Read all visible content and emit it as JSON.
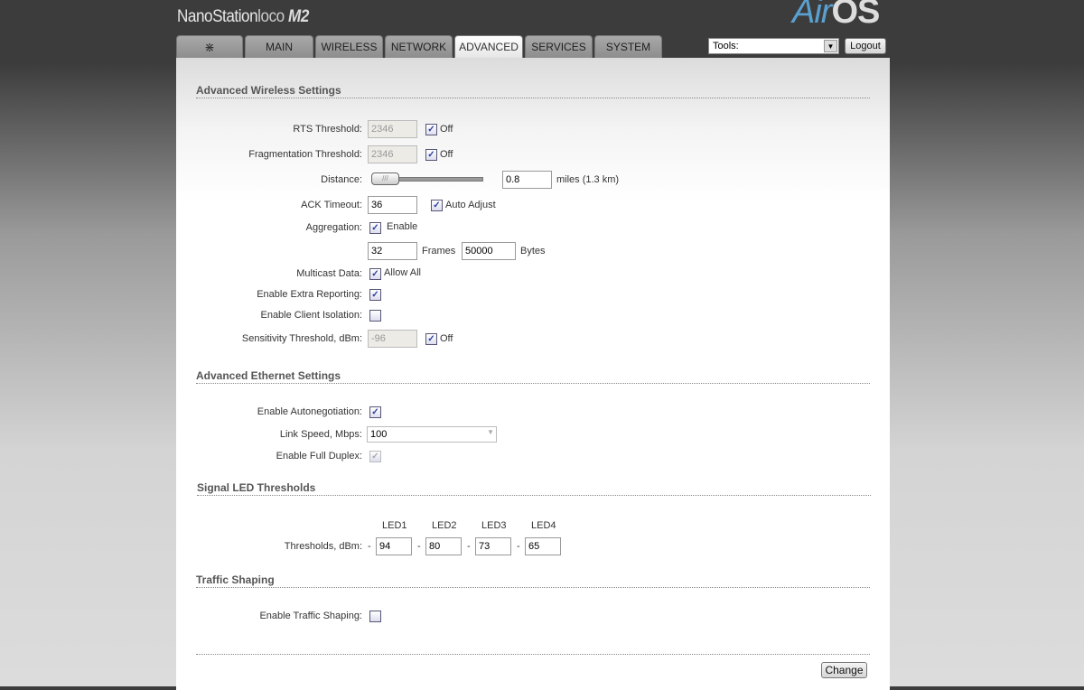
{
  "header": {
    "product": "NanoStation",
    "model": "loco",
    "model_suffix": "M2",
    "logo_air": "Air",
    "logo_os": "OS"
  },
  "tabs": [
    {
      "label": ""
    },
    {
      "label": "MAIN"
    },
    {
      "label": "WIRELESS"
    },
    {
      "label": "NETWORK"
    },
    {
      "label": "ADVANCED"
    },
    {
      "label": "SERVICES"
    },
    {
      "label": "SYSTEM"
    }
  ],
  "tools": {
    "value": "Tools:"
  },
  "logout": "Logout",
  "wireless": {
    "title": "Advanced Wireless Settings",
    "rts_label": "RTS Threshold:",
    "rts_value": "2346",
    "rts_off": "Off",
    "frag_label": "Fragmentation Threshold:",
    "frag_value": "2346",
    "frag_off": "Off",
    "distance_label": "Distance:",
    "distance_value": "0.8",
    "distance_unit": "miles (1.3 km)",
    "ack_label": "ACK Timeout:",
    "ack_value": "36",
    "ack_auto": "Auto Adjust",
    "agg_label": "Aggregation:",
    "agg_enable": "Enable",
    "agg_frames": "32",
    "frames_label": "Frames",
    "agg_bytes": "50000",
    "bytes_label": "Bytes",
    "multicast_label": "Multicast Data:",
    "multicast_allow": "Allow All",
    "extra_label": "Enable Extra Reporting:",
    "isolation_label": "Enable Client Isolation:",
    "sens_label": "Sensitivity Threshold, dBm:",
    "sens_value": "-96",
    "sens_off": "Off"
  },
  "ethernet": {
    "title": "Advanced Ethernet Settings",
    "autoneg_label": "Enable Autonegotiation:",
    "speed_label": "Link Speed, Mbps:",
    "speed_value": "100",
    "duplex_label": "Enable Full Duplex:"
  },
  "led": {
    "title": "Signal LED Thresholds",
    "label": "Thresholds, dBm:",
    "heads": [
      "LED1",
      "LED2",
      "LED3",
      "LED4"
    ],
    "values": [
      "94",
      "80",
      "73",
      "65"
    ],
    "dash": "-"
  },
  "traffic": {
    "title": "Traffic Shaping",
    "label": "Enable Traffic Shaping:"
  },
  "change": "Change"
}
